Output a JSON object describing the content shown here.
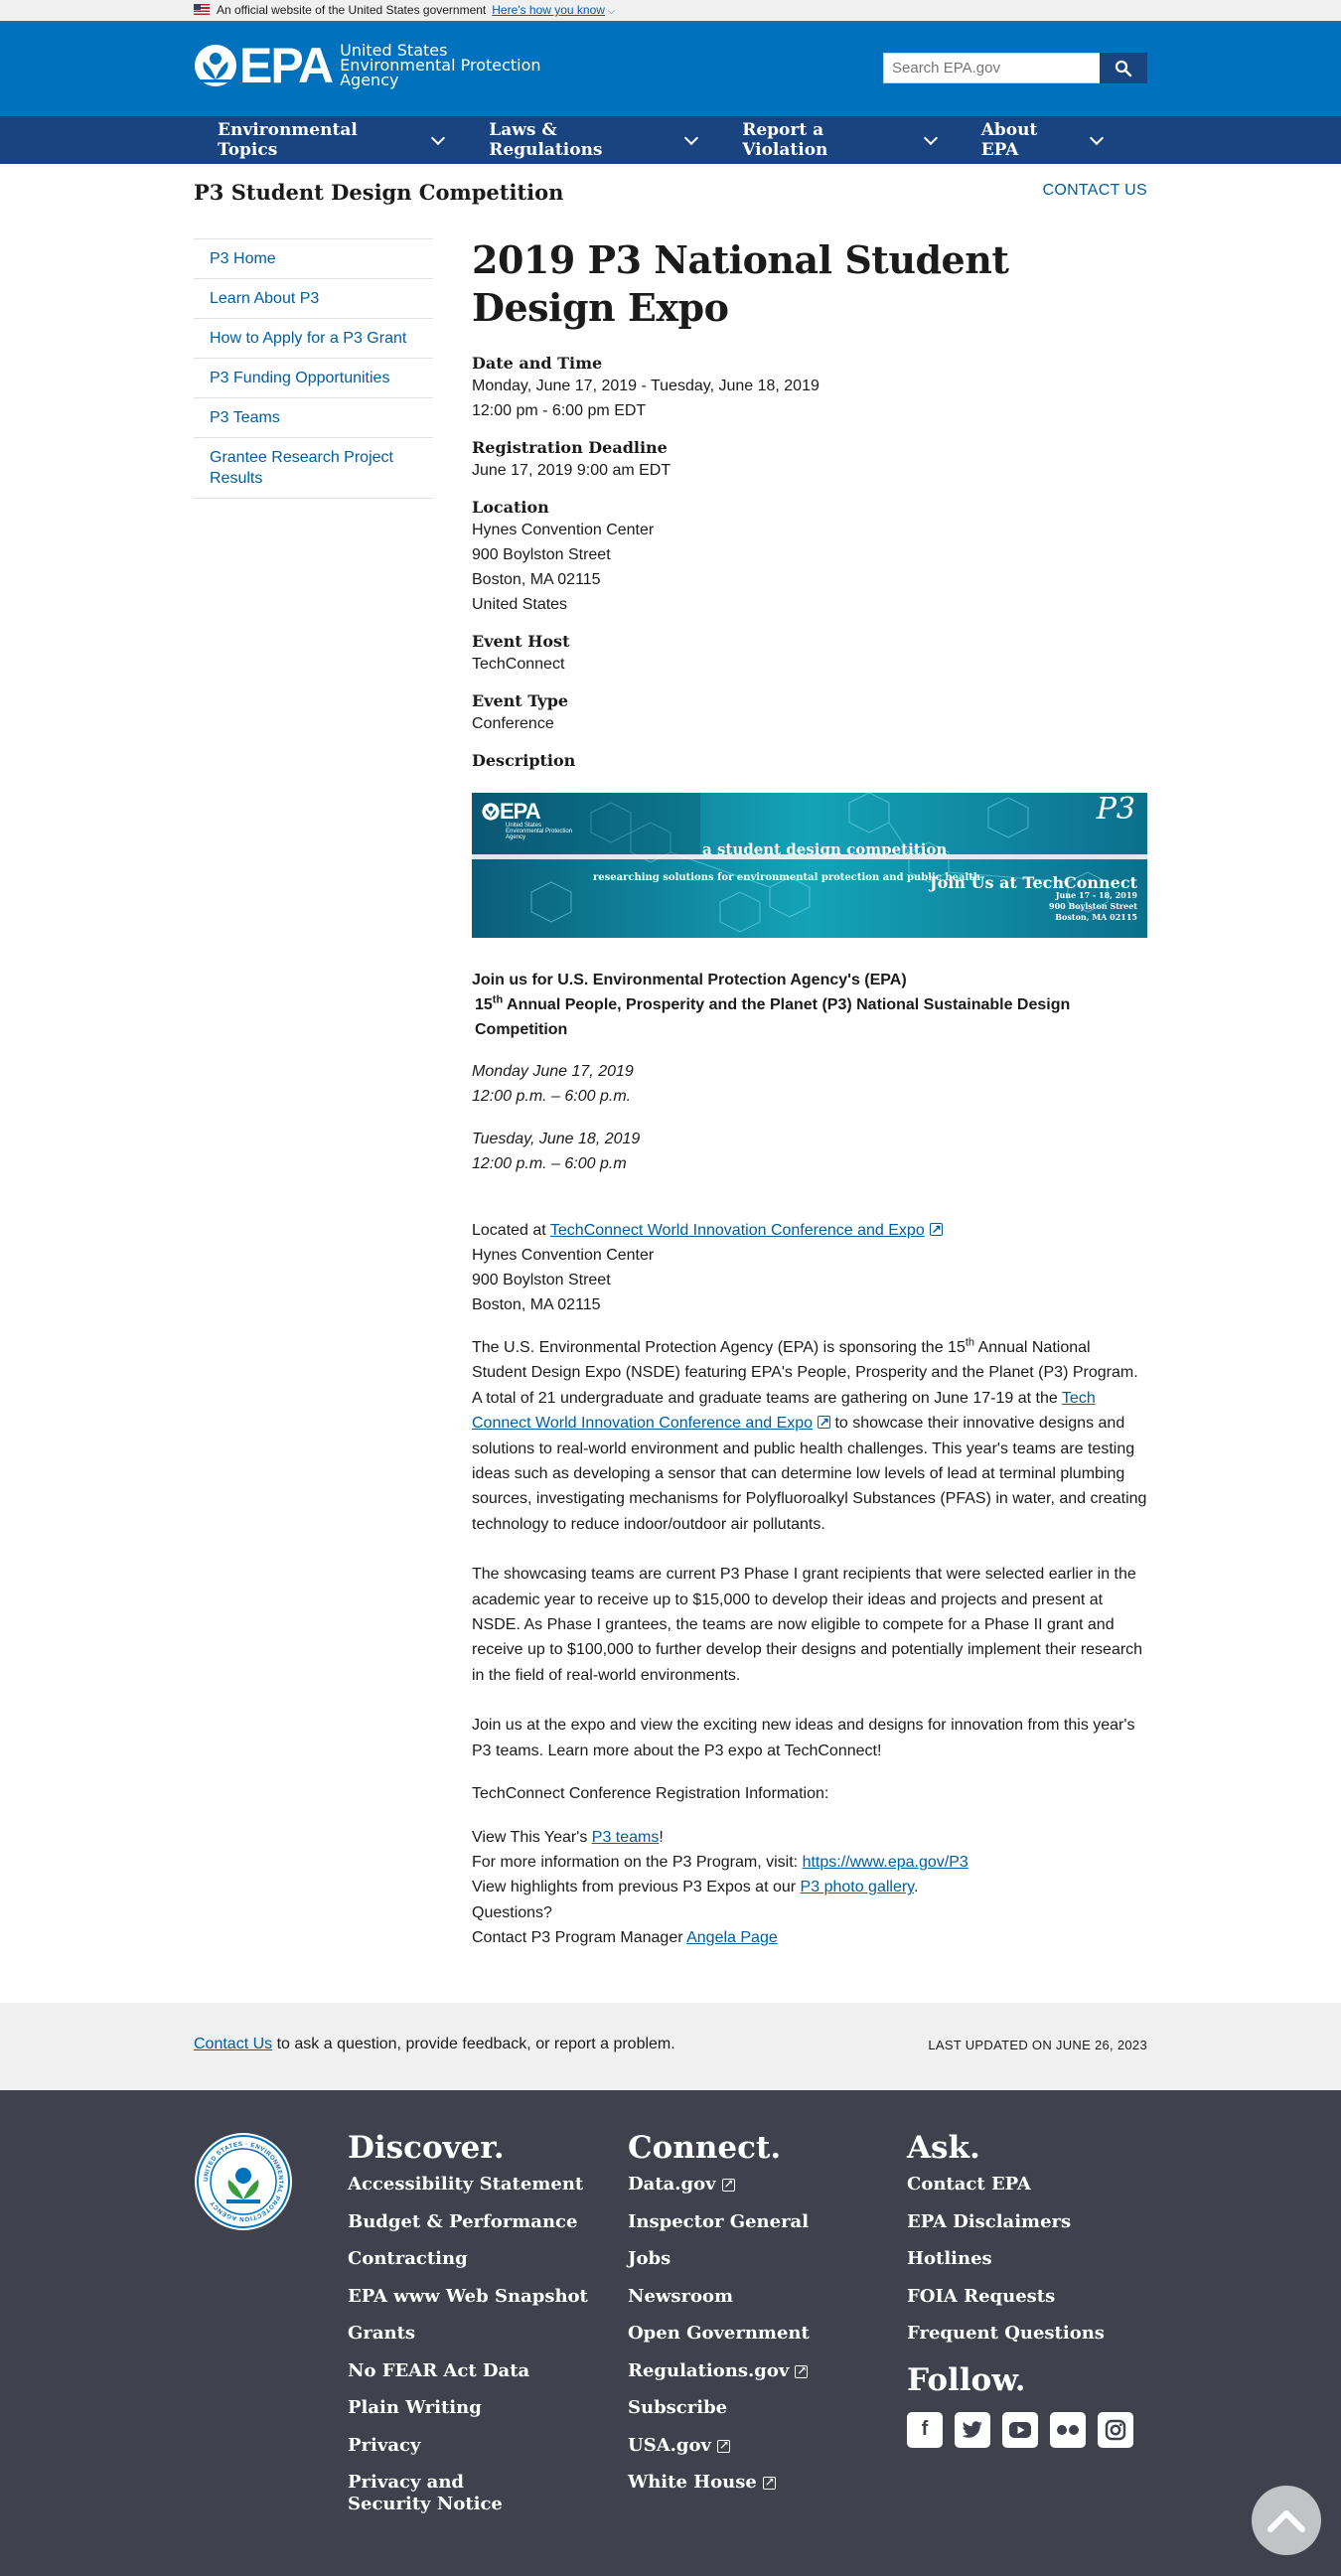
{
  "gov_banner": {
    "text": "An official website of the United States government",
    "how_link": "Here's how you know"
  },
  "header": {
    "logo_text": "EPA",
    "logo_sub": [
      "United States",
      "Environmental Protection",
      "Agency"
    ],
    "search_placeholder": "Search EPA.gov"
  },
  "nav": {
    "items": [
      "Environmental Topics",
      "Laws & Regulations",
      "Report a Violation",
      "About EPA"
    ]
  },
  "subhead": {
    "title": "P3 Student Design Competition",
    "contact": "CONTACT US"
  },
  "sidebar": {
    "items": [
      "P3 Home",
      "Learn About P3",
      "How to Apply for a P3 Grant",
      "P3 Funding Opportunities",
      "P3 Teams",
      "Grantee Research Project Results"
    ]
  },
  "main": {
    "title": "2019 P3 National Student Design Expo",
    "date_label": "Date and Time",
    "date_line1": "Monday, June 17, 2019 - Tuesday, June 18, 2019",
    "date_line2": "12:00 pm - 6:00 pm EDT",
    "reg_label": "Registration Deadline",
    "reg_value": "June 17, 2019 9:00 am EDT",
    "loc_label": "Location",
    "loc_lines": [
      "Hynes Convention Center",
      "900 Boylston Street",
      "Boston, MA 02115",
      "United States"
    ],
    "host_label": "Event Host",
    "host_value": "TechConnect",
    "type_label": "Event Type",
    "type_value": "Conference",
    "desc_label": "Description",
    "banner": {
      "logo": "EPA",
      "logo_sub": [
        "United States",
        "Environmental Protection",
        "Agency"
      ],
      "headline": "a student design competition",
      "tagline": "researching solutions for environmental protection and public health",
      "join": "Join Us at TechConnect",
      "dates": "June 17 - 18, 2019",
      "street": "900 Boylston Street",
      "city": "Boston, MA 02115",
      "p3": "P3"
    },
    "intro_line1": "Join us for U.S. Environmental Protection Agency's (EPA)",
    "intro_num": "15",
    "intro_sup": "th",
    "intro_line2": " Annual People, Prosperity and the Planet (P3) National Sustainable Design Competition",
    "day1": "Monday June 17, 2019",
    "day1_time": "12:00 p.m. – 6:00 p.m.",
    "day2": "Tuesday, June 18, 2019",
    "day2_time": "12:00 p.m. – 6:00 p.m",
    "located_at": "Located at ",
    "located_link": "TechConnect World Innovation Conference and Expo",
    "located_lines": [
      "Hynes Convention Center",
      "900 Boylston Street",
      "Boston, MA 02115"
    ],
    "p1_a": "The U.S. Environmental Protection Agency (EPA) is sponsoring the 15",
    "p1_sup": "th",
    "p1_b": " Annual National Student Design Expo (NSDE) featuring EPA's People, Prosperity and the Planet (P3) Program. A total of 21 undergraduate and graduate teams are gathering on June 17-19 at the ",
    "p1_link": "Tech Connect World Innovation Conference and Expo",
    "p1_c": " to showcase their innovative designs and solutions to real-world environment and public health challenges. This year's teams are testing ideas such as developing a sensor that can determine low levels of lead at terminal plumbing sources, investigating mechanisms for Polyfluoroalkyl Substances (PFAS) in water, and creating technology to reduce indoor/outdoor air pollutants.",
    "p2": "The showcasing teams are current P3 Phase I grant recipients that were selected earlier in the academic year to receive up to $15,000 to develop their ideas and projects and present at NSDE. As Phase I grantees, the teams are now eligible to compete for a Phase II grant and receive up to $100,000 to further develop their designs and potentially implement their research in the field of real-world environments.",
    "p3": "Join us at the expo and view the exciting new ideas and designs for innovation from this year's P3 teams. Learn more about the P3 expo at TechConnect!",
    "p4": "TechConnect Conference Registration Information:",
    "l1_a": "View This Year's ",
    "l1_link": "P3 teams",
    "l1_b": "!",
    "l2_a": "For more information on the P3 Program, visit: ",
    "l2_link": "https://www.epa.gov/P3",
    "l3_a": "View highlights from previous P3 Expos at our ",
    "l3_link": "P3 photo gallery",
    "l3_b": ".",
    "l4": "Questions?",
    "l5_a": "Contact P3 Program Manager ",
    "l5_link": "Angela Page"
  },
  "footer_bar": {
    "contact_link": "Contact Us",
    "contact_text": " to ask a question, provide feedback, or report a problem.",
    "updated": "LAST UPDATED ON JUNE 26, 2023"
  },
  "footer": {
    "seal_text": "UNITED STATES · ENVIRONMENTAL PROTECTION AGENCY",
    "discover": {
      "title": "Discover.",
      "links": [
        "Accessibility Statement",
        "Budget & Performance",
        "Contracting",
        "EPA www Web Snapshot",
        "Grants",
        "No FEAR Act Data",
        "Plain Writing",
        "Privacy",
        "Privacy and Security Notice"
      ]
    },
    "connect": {
      "title": "Connect.",
      "links": [
        "Data.gov",
        "Inspector General",
        "Jobs",
        "Newsroom",
        "Open Government",
        "Regulations.gov",
        "Subscribe",
        "USA.gov",
        "White House"
      ]
    },
    "ask": {
      "title": "Ask.",
      "links": [
        "Contact EPA",
        "EPA Disclaimers",
        "Hotlines",
        "FOIA Requests",
        "Frequent Questions"
      ]
    },
    "follow": {
      "title": "Follow.",
      "icons": [
        "facebook-icon",
        "twitter-icon",
        "youtube-icon",
        "flickr-icon",
        "instagram-icon"
      ]
    }
  }
}
